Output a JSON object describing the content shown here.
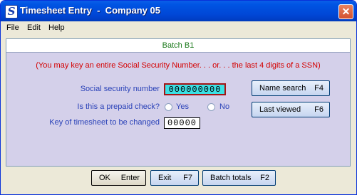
{
  "window": {
    "icon_glyph": "S",
    "title": "Timesheet Entry  -  Company 05",
    "close_glyph": "✕"
  },
  "menu": [
    "File",
    "Edit",
    "Help"
  ],
  "batch_label": "Batch B1",
  "hint": "(You may key an entire Social Security Number. . . or. . . the last 4 digits of a SSN)",
  "ssn": {
    "label": "Social security number",
    "value": "000000000"
  },
  "prepaid": {
    "label": "Is this a prepaid check?",
    "yes": "Yes",
    "no": "No"
  },
  "key": {
    "label": "Key of timesheet to be changed",
    "value": "00000"
  },
  "buttons": {
    "name_search": {
      "label": "Name search",
      "key": "F4"
    },
    "last_viewed": {
      "label": "Last viewed",
      "key": "F6"
    },
    "ok": {
      "label": "OK",
      "key": "Enter"
    },
    "exit": {
      "label": "Exit",
      "key": "F7"
    },
    "batch_totals": {
      "label": "Batch totals",
      "key": "F2"
    }
  },
  "colors": {
    "ssn_bg": "#3ce0e4",
    "label": "#2a42b8",
    "hint": "#d40000",
    "batch": "#1c7a1c"
  }
}
